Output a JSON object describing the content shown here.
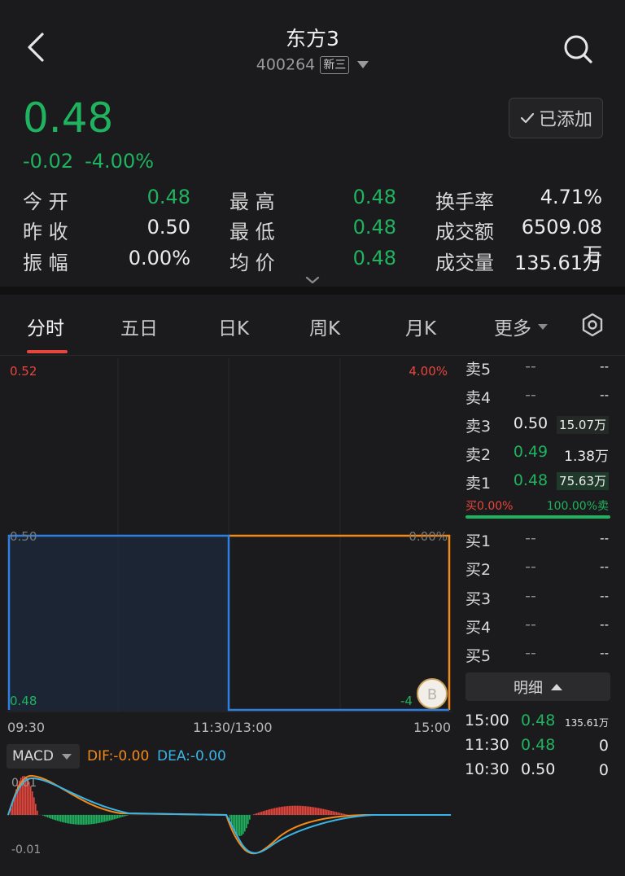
{
  "header": {
    "title": "东方3",
    "code": "400264",
    "badge": "新三"
  },
  "quote": {
    "price": "0.48",
    "change": "-0.02",
    "change_pct": "-4.00%",
    "added_label": "已添加",
    "stats": [
      {
        "label": "今 开",
        "value": "0.48",
        "color": "green"
      },
      {
        "label": "最 高",
        "value": "0.48",
        "color": "green"
      },
      {
        "label": "换手率",
        "value": "4.71%",
        "color": "white"
      },
      {
        "label": "昨 收",
        "value": "0.50",
        "color": "white"
      },
      {
        "label": "最 低",
        "value": "0.48",
        "color": "green"
      },
      {
        "label": "成交额",
        "value": "6509.08万",
        "color": "white"
      },
      {
        "label": "振 幅",
        "value": "0.00%",
        "color": "white"
      },
      {
        "label": "均 价",
        "value": "0.48",
        "color": "green"
      },
      {
        "label": "成交量",
        "value": "135.61万",
        "color": "white"
      }
    ]
  },
  "tabs": [
    "分时",
    "五日",
    "日K",
    "周K",
    "月K",
    "更多"
  ],
  "chart": {
    "price_top": "0.52",
    "price_mid": "0.50",
    "price_bot": "0.48",
    "pct_top": "4.00%",
    "pct_mid": "0.00%",
    "pct_bot": "-4",
    "times": [
      "09:30",
      "11:30/13:00",
      "15:00"
    ],
    "marker_label": "B"
  },
  "macd": {
    "label": "MACD",
    "dif": "DIF:-0.00",
    "dea": "DEA:-0.00",
    "top": "0.01",
    "bot": "-0.01"
  },
  "orderbook": {
    "asks": [
      {
        "label": "卖5",
        "price": "--",
        "vol": "--",
        "color": "gray"
      },
      {
        "label": "卖4",
        "price": "--",
        "vol": "--",
        "color": "gray"
      },
      {
        "label": "卖3",
        "price": "0.50",
        "vol": "15.07万",
        "color": "white"
      },
      {
        "label": "卖2",
        "price": "0.49",
        "vol": "1.38万",
        "color": "green"
      },
      {
        "label": "卖1",
        "price": "0.48",
        "vol": "75.63万",
        "color": "green"
      }
    ],
    "buy_ratio": "买0.00%",
    "sell_ratio": "100.00%卖",
    "bids": [
      {
        "label": "买1",
        "price": "--",
        "vol": "--"
      },
      {
        "label": "买2",
        "price": "--",
        "vol": "--"
      },
      {
        "label": "买3",
        "price": "--",
        "vol": "--"
      },
      {
        "label": "买4",
        "price": "--",
        "vol": "--"
      },
      {
        "label": "买5",
        "price": "--",
        "vol": "--"
      }
    ],
    "detail_label": "明细"
  },
  "trades": [
    {
      "time": "15:00",
      "price": "0.48",
      "vol": "135.61万",
      "color": "green"
    },
    {
      "time": "11:30",
      "price": "0.48",
      "vol": "0",
      "color": "green"
    },
    {
      "time": "10:30",
      "price": "0.50",
      "vol": "0",
      "color": "white"
    }
  ]
}
